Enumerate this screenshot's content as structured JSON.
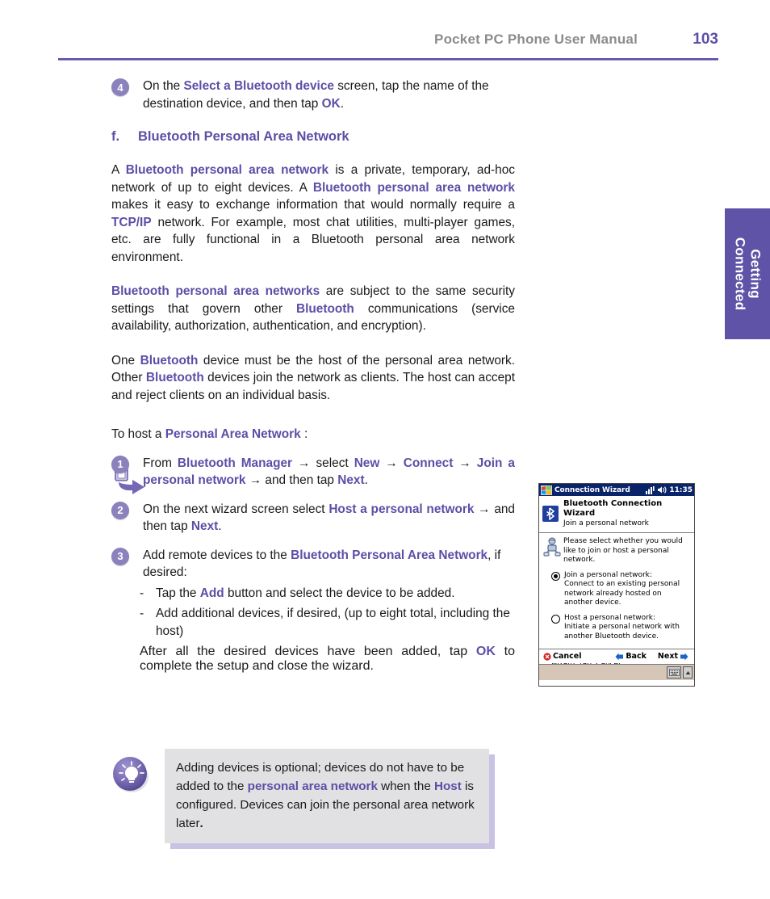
{
  "header": {
    "title": "Pocket PC Phone User Manual",
    "page_number": "103",
    "accent_color": "#5b4fa6",
    "title_color": "#8c8c8c"
  },
  "side_tab": {
    "line1": "Getting",
    "line2": "Connected",
    "background": "#5f53a8",
    "text_color": "#ffffff"
  },
  "step4": {
    "badge": "4",
    "text_a": "On the ",
    "accent_a": "Select a Bluetooth device",
    "text_b": " screen, tap the name of the destination device, and then tap ",
    "accent_b": "OK",
    "text_c": "."
  },
  "section": {
    "letter": "f.",
    "title": "Bluetooth Personal Area Network"
  },
  "paragraph1": {
    "t1": "A ",
    "a1": "Bluetooth personal area network",
    "t2": " is a private, temporary, ad-hoc network of up to eight devices. A ",
    "a2": "Bluetooth personal area network",
    "t3": " makes it easy to exchange information that would normally require a ",
    "a3": "TCP/IP",
    "t4": " network. For example, most chat utilities, multi-player games, etc. are fully functional in a Bluetooth personal area network environment."
  },
  "paragraph2": {
    "a1": "Bluetooth personal area networks",
    "t1": " are subject to the same security settings that govern other ",
    "a2": "Bluetooth",
    "t2": " communications (service availability, authorization, authentication, and encryption)."
  },
  "paragraph3": {
    "t1": "One ",
    "a1": "Bluetooth",
    "t2": " device must be the host of the personal area network. Other ",
    "a2": "Bluetooth",
    "t3": " devices join the network as clients. The host can accept and reject clients on an individual basis."
  },
  "host_intro": {
    "t1": "To host a ",
    "a1": "Personal Area Network",
    "t2": " :"
  },
  "step1": {
    "badge": "1",
    "t1": "From ",
    "a1": "Bluetooth Manager",
    "arrow1": " → ",
    "t2": "select ",
    "a2": "New",
    "arrow2": " → ",
    "a3": "Connect",
    "arrow3": " → ",
    "a4": "Join a personal network",
    "arrow4": " → ",
    "t3": "and then tap ",
    "a5": "Next",
    "t4": "."
  },
  "step2": {
    "badge": "2",
    "t1": "On the next wizard screen select ",
    "a1": "Host a personal network",
    "arrow1": " → ",
    "t2": "and then tap ",
    "a2": "Next",
    "t3": "."
  },
  "step3": {
    "badge": "3",
    "t1": "Add remote devices to the ",
    "a1": "Bluetooth Personal Area Network",
    "t2": ", if desired:",
    "bullets": [
      {
        "mark": "-",
        "t1": "Tap the ",
        "a1": "Add",
        "t2": " button and select the device to be added."
      },
      {
        "mark": "-",
        "t1": "Add additional devices, if desired, (up to eight total, including the host)",
        "a1": "",
        "t2": ""
      }
    ],
    "closing": {
      "t1": "After all the desired devices have been added, tap ",
      "a1": "OK",
      "t2": " to complete the setup and close the wizard."
    }
  },
  "note": {
    "icon": "lightbulb-icon",
    "t1": "Adding devices is optional; devices do not have to be added to the ",
    "a1": "personal area network",
    "t2": " when the ",
    "a2": "Host",
    "t3": " is configured. Devices can join the personal area network later",
    "t4": ".",
    "background": "#e1e0e2",
    "shadow_color": "#c9c2e4"
  },
  "pda": {
    "titlebar": {
      "title": "Connection Wizard",
      "clock": "11:35",
      "signal_icon": "signal-bars-icon",
      "speaker_icon": "speaker-icon",
      "start_icon": "windows-start-icon",
      "background": "#0a246a"
    },
    "app_header": {
      "icon": "bluetooth-icon",
      "title": "Bluetooth Connection Wizard",
      "subtitle": "Join a personal network"
    },
    "prompt": {
      "icon": "network-wizard-icon",
      "text": "Please select whether you would like to join or host a personal network."
    },
    "options": [
      {
        "selected": true,
        "label": "Join a personal network:",
        "description": "Connect to an existing personal network already hosted on another device."
      },
      {
        "selected": false,
        "label": "Host a personal network:",
        "description": "Initiate a personal network with another Bluetooth device."
      }
    ],
    "tap_note": "Tap 'Next' to continue. To exit this wizard, tap 'Cancel'.",
    "commands": [
      {
        "label": "Cancel",
        "icon": "cancel-icon"
      },
      {
        "label": "Back",
        "icon": "back-arrow-icon"
      },
      {
        "label": "Next",
        "icon": "next-arrow-icon"
      }
    ],
    "sip": {
      "keyboard_icon": "keyboard-icon",
      "chevron_icon": "chevron-up-icon"
    }
  }
}
